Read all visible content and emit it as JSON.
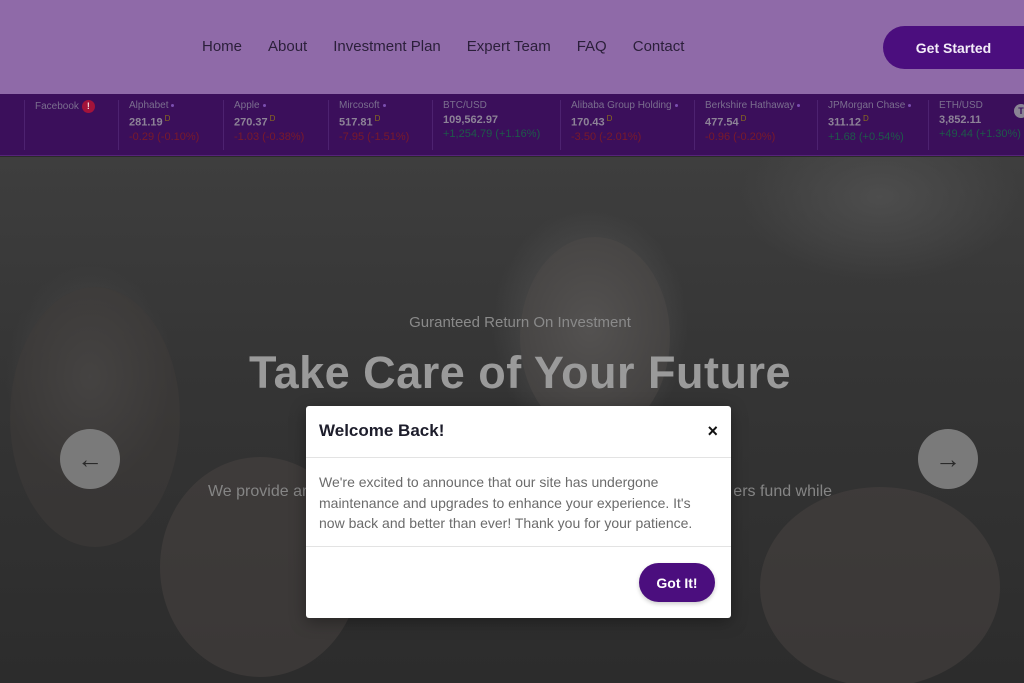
{
  "header": {
    "nav": [
      "Home",
      "About",
      "Investment Plan",
      "Expert Team",
      "FAQ",
      "Contact"
    ],
    "cta_label": "Get Started"
  },
  "ticker": [
    {
      "name": "Facebook",
      "price": "",
      "change": "",
      "badge": "!"
    },
    {
      "name": "Alphabet",
      "price": "281.19",
      "unit": "D",
      "change": "-0.29 (-0.10%)",
      "dir": "neg"
    },
    {
      "name": "Apple",
      "price": "270.37",
      "unit": "D",
      "change": "-1.03 (-0.38%)",
      "dir": "neg"
    },
    {
      "name": "Mircosoft",
      "price": "517.81",
      "unit": "D",
      "change": "-7.95 (-1.51%)",
      "dir": "neg"
    },
    {
      "name": "BTC/USD",
      "price": "109,562.97",
      "unit": "",
      "change": "+1,254.79 (+1.16%)",
      "dir": "pos"
    },
    {
      "name": "Alibaba Group Holding",
      "price": "170.43",
      "unit": "D",
      "change": "-3.50 (-2.01%)",
      "dir": "neg"
    },
    {
      "name": "Berkshire Hathaway",
      "price": "477.54",
      "unit": "D",
      "change": "-0.96 (-0.20%)",
      "dir": "neg"
    },
    {
      "name": "JPMorgan Chase",
      "price": "311.12",
      "unit": "D",
      "change": "+1.68 (+0.54%)",
      "dir": "pos"
    },
    {
      "name": "ETH/USD",
      "price": "3,852.11",
      "unit": "",
      "change": "+49.44 (+1.30%)",
      "dir": "pos"
    }
  ],
  "ticker_tail": "T",
  "hero": {
    "subtitle": "Guranteed Return On Investment",
    "title": "Take Care of Your Future",
    "desc_left": "We provide ar",
    "desc_right": "ers fund while",
    "prev_icon": "←",
    "next_icon": "→"
  },
  "modal": {
    "title": "Welcome Back!",
    "close": "×",
    "body": "We're excited to announce that our site has undergone maintenance and upgrades to enhance your experience. It's now back and better than ever! Thank you for your patience.",
    "button": "Got It!"
  }
}
